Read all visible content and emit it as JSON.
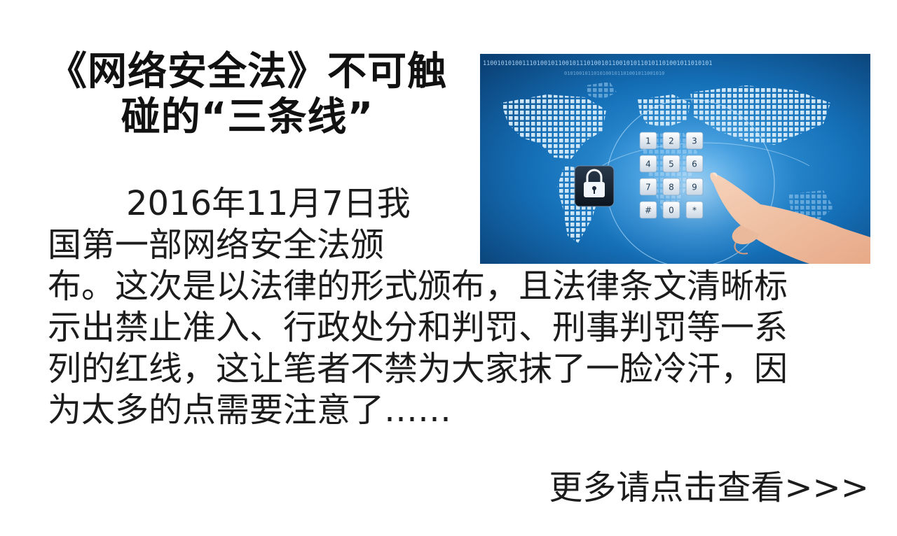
{
  "article": {
    "title_lines": [
      "《网络安全法》不可触",
      "碰的“三条线”"
    ],
    "body_lines": [
      "2016年11月7日我",
      "国第一部网络安全法颁",
      "布。这次是以法律的形式颁布，且法律条文清晰标",
      "示出禁止准入、行政处分和判罚、刑事判罚等一系",
      "列的红线，这让笔者不禁为大家抹了一脸冷汗，因",
      "为太多的点需要注意了……"
    ],
    "more_link": "更多请点击查看>>>"
  },
  "hero_image": {
    "binary_strip": "1100101010011101001011001011101001011001010110101101001011010101",
    "keypad_keys": [
      "1",
      "2",
      "3",
      "4",
      "5",
      "6",
      "7",
      "8",
      "9",
      "#",
      "0",
      "*"
    ],
    "icons": [
      "padlock-icon",
      "pointing-hand-icon"
    ],
    "colors": {
      "background": "#0e5d9e",
      "map_dots": "#cfe6fb",
      "key_face": "#eef3f8",
      "lock_box": "#15202c",
      "skin": "#f2c3a3"
    }
  }
}
